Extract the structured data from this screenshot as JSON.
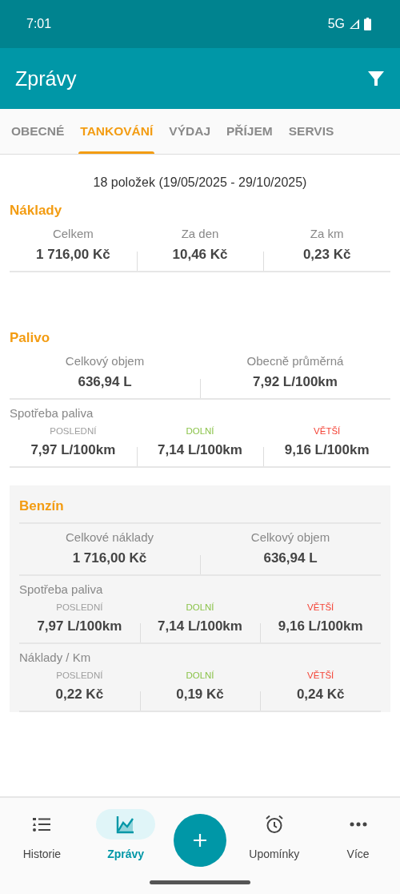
{
  "status_bar": {
    "time": "7:01",
    "network": "5G"
  },
  "app_bar": {
    "title": "Zprávy"
  },
  "tabs": [
    {
      "label": "OBECNÉ",
      "selected": false
    },
    {
      "label": "TANKOVÁNÍ",
      "selected": true
    },
    {
      "label": "VÝDAJ",
      "selected": false
    },
    {
      "label": "PŘÍJEM",
      "selected": false
    },
    {
      "label": "SERVIS",
      "selected": false
    }
  ],
  "summary": "18 položek (19/05/2025 - 29/10/2025)",
  "sections": [
    {
      "kind": "plain",
      "title": "Náklady",
      "groups": [
        {
          "kind": "summary",
          "stats": [
            {
              "label": "Celkem",
              "value": "1 716,00 Kč"
            },
            {
              "label": "Za den",
              "value": "10,46 Kč"
            },
            {
              "label": "Za km",
              "value": "0,23 Kč"
            }
          ]
        }
      ]
    },
    {
      "kind": "plain",
      "title": "Palivo",
      "groups": [
        {
          "kind": "summary",
          "stats": [
            {
              "label": "Celkový objem",
              "value": "636,94 L"
            },
            {
              "label": "Obecně průměrná",
              "value": "7,92 L/100km"
            }
          ]
        },
        {
          "kind": "range",
          "label": "Spotřeba paliva",
          "stats": [
            {
              "label": "POSLEDNÍ",
              "color": "#9e9e9e",
              "value": "7,97 L/100km"
            },
            {
              "label": "DOLNÍ",
              "color": "#8bc34a",
              "value": "7,14 L/100km"
            },
            {
              "label": "VĚTŠÍ",
              "color": "#f44336",
              "value": "9,16 L/100km"
            }
          ]
        }
      ]
    },
    {
      "kind": "card",
      "title": "Benzín",
      "groups": [
        {
          "kind": "summary",
          "stats": [
            {
              "label": "Celkové náklady",
              "value": "1 716,00 Kč"
            },
            {
              "label": "Celkový objem",
              "value": "636,94 L"
            }
          ]
        },
        {
          "kind": "range",
          "label": "Spotřeba paliva",
          "stats": [
            {
              "label": "POSLEDNÍ",
              "color": "#9e9e9e",
              "value": "7,97 L/100km"
            },
            {
              "label": "DOLNÍ",
              "color": "#8bc34a",
              "value": "7,14 L/100km"
            },
            {
              "label": "VĚTŠÍ",
              "color": "#f44336",
              "value": "9,16 L/100km"
            }
          ]
        },
        {
          "kind": "range",
          "label": "Náklady / Km",
          "stats": [
            {
              "label": "POSLEDNÍ",
              "color": "#9e9e9e",
              "value": "0,22 Kč"
            },
            {
              "label": "DOLNÍ",
              "color": "#8bc34a",
              "value": "0,19 Kč"
            },
            {
              "label": "VĚTŠÍ",
              "color": "#f44336",
              "value": "0,24 Kč"
            }
          ]
        }
      ]
    }
  ],
  "bottom_nav": [
    {
      "kind": "list",
      "label": "Historie",
      "selected": false
    },
    {
      "kind": "chart",
      "label": "Zprávy",
      "selected": true
    },
    {
      "kind": "add"
    },
    {
      "kind": "alarm",
      "label": "Upomínky",
      "selected": false
    },
    {
      "kind": "more",
      "label": "Více",
      "selected": false
    }
  ]
}
